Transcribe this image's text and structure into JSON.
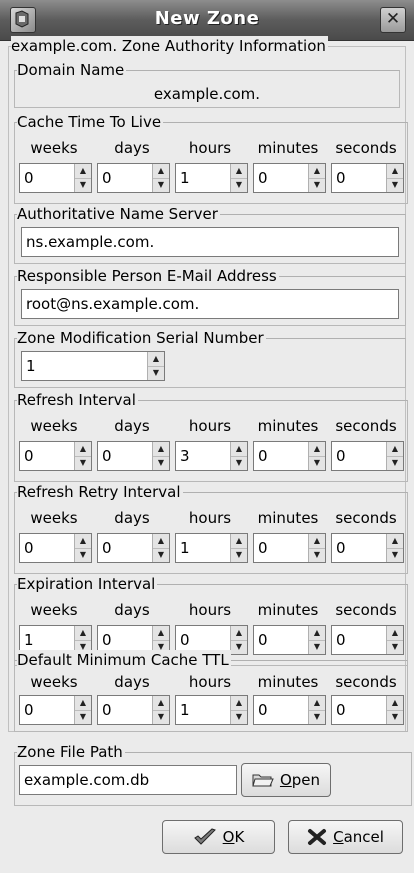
{
  "window": {
    "title": "New Zone",
    "close_glyph": "✕",
    "app_icon": "zone-app-icon"
  },
  "zone_authority": {
    "legend": "example.com. Zone Authority Information"
  },
  "domain_name": {
    "legend": "Domain Name",
    "value": "example.com."
  },
  "time_units": [
    "weeks",
    "days",
    "hours",
    "minutes",
    "seconds"
  ],
  "cache_ttl": {
    "legend": "Cache Time To Live",
    "values": [
      "0",
      "0",
      "1",
      "0",
      "0"
    ]
  },
  "name_server": {
    "legend": "Authoritative Name Server",
    "value": "ns.example.com."
  },
  "email": {
    "legend": "Responsible Person E-Mail Address",
    "value": "root@ns.example.com."
  },
  "serial": {
    "legend": "Zone Modification Serial Number",
    "value": "1"
  },
  "refresh": {
    "legend": "Refresh Interval",
    "values": [
      "0",
      "0",
      "3",
      "0",
      "0"
    ]
  },
  "retry": {
    "legend": "Refresh Retry Interval",
    "values": [
      "0",
      "0",
      "1",
      "0",
      "0"
    ]
  },
  "expiration": {
    "legend": "Expiration Interval",
    "values": [
      "1",
      "0",
      "0",
      "0",
      "0"
    ]
  },
  "min_ttl": {
    "legend": "Default Minimum Cache TTL",
    "values": [
      "0",
      "0",
      "1",
      "0",
      "0"
    ]
  },
  "file_path": {
    "legend": "Zone File Path",
    "value": "example.com.db",
    "open_label": "Open",
    "open_mnemonic": "O",
    "open_rest": "pen"
  },
  "buttons": {
    "ok_mnemonic": "O",
    "ok_rest": "K",
    "cancel_mnemonic": "C",
    "cancel_rest": "ancel"
  }
}
